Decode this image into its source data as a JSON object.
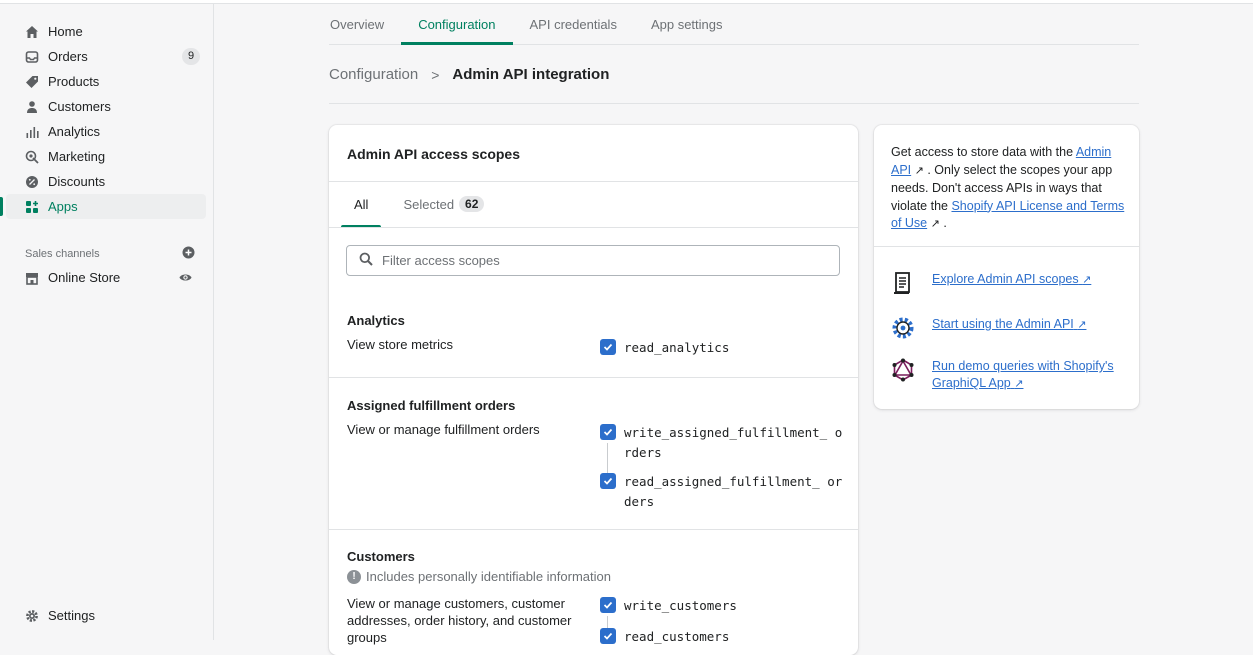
{
  "sidebar": {
    "items": [
      {
        "label": "Home",
        "icon": "home-icon"
      },
      {
        "label": "Orders",
        "icon": "orders-icon",
        "badge": "9"
      },
      {
        "label": "Products",
        "icon": "tag-icon"
      },
      {
        "label": "Customers",
        "icon": "person-icon"
      },
      {
        "label": "Analytics",
        "icon": "analytics-icon"
      },
      {
        "label": "Marketing",
        "icon": "marketing-icon"
      },
      {
        "label": "Discounts",
        "icon": "discount-icon"
      },
      {
        "label": "Apps",
        "icon": "apps-icon",
        "active": true
      }
    ],
    "sales_channels_label": "Sales channels",
    "online_store_label": "Online Store",
    "settings_label": "Settings"
  },
  "tabs": [
    {
      "label": "Overview"
    },
    {
      "label": "Configuration",
      "active": true
    },
    {
      "label": "API credentials"
    },
    {
      "label": "App settings"
    }
  ],
  "breadcrumb": {
    "parent": "Configuration",
    "separator": ">",
    "current": "Admin API integration"
  },
  "scopes_card": {
    "title": "Admin API access scopes",
    "tab_all": "All",
    "tab_selected": "Selected",
    "selected_count": "62",
    "filter_placeholder": "Filter access scopes",
    "sections": [
      {
        "title": "Analytics",
        "description": "View store metrics",
        "scopes": [
          "read_analytics"
        ]
      },
      {
        "title": "Assigned fulfillment orders",
        "description": "View or manage fulfillment orders",
        "scopes": [
          "write_assigned_fulfillment_ orders",
          "read_assigned_fulfillment_ orders"
        ]
      },
      {
        "title": "Customers",
        "pii_note": "Includes personally identifiable information",
        "description": "View or manage customers, customer addresses, order history, and customer groups",
        "scopes": [
          "write_customers",
          "read_customers"
        ]
      }
    ]
  },
  "info_card": {
    "text_prefix": "Get access to store data with the ",
    "link_admin_api": "Admin API",
    "text_middle": " . Only select the scopes your app needs. Don't access APIs in ways that violate the ",
    "link_license": "Shopify API License and Terms of Use",
    "text_suffix": " .",
    "resources": [
      {
        "label": "Explore Admin API scopes",
        "icon": "scroll-icon"
      },
      {
        "label": "Start using the Admin API",
        "icon": "gear-icon"
      },
      {
        "label": "Run demo queries with Shopify's GraphiQL App",
        "icon": "graphql-icon"
      }
    ]
  },
  "colors": {
    "accent_green": "#008060",
    "link_blue": "#2c6ecb",
    "checkbox_blue": "#2c6ecb"
  }
}
